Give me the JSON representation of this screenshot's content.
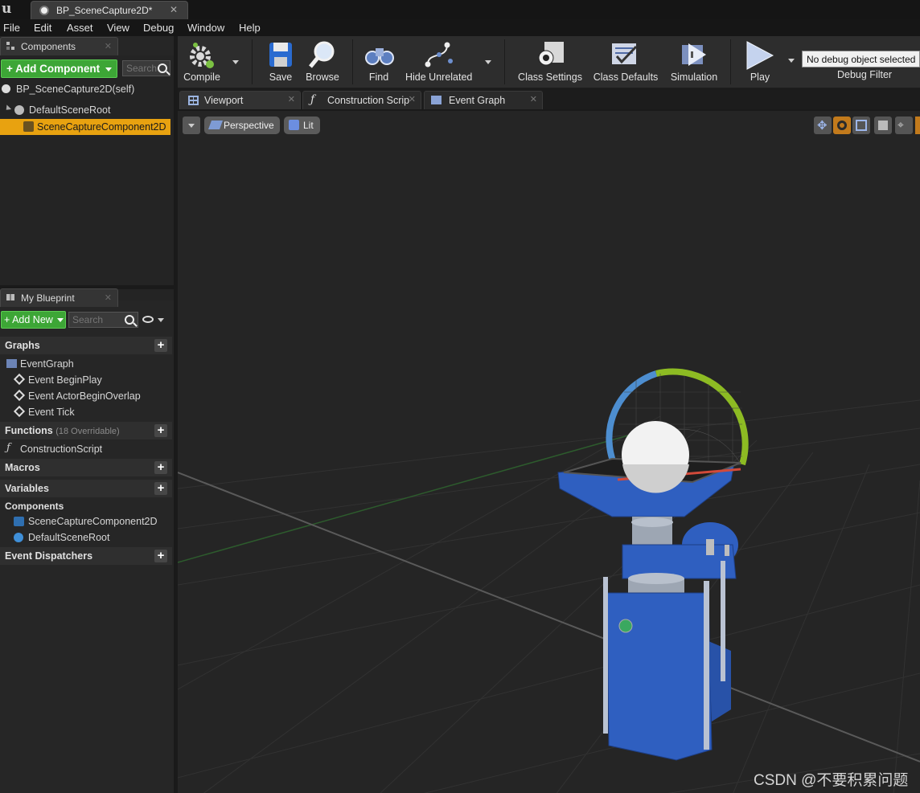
{
  "window": {
    "tab_title": "BP_SceneCapture2D*",
    "logo": "u"
  },
  "menu": [
    "File",
    "Edit",
    "Asset",
    "View",
    "Debug",
    "Window",
    "Help"
  ],
  "components_panel": {
    "tab_label": "Components",
    "add_component": "+ Add Component",
    "search_placeholder": "Search",
    "self_label": "BP_SceneCapture2D(self)",
    "tree": [
      "DefaultSceneRoot",
      "SceneCaptureComponent2D"
    ]
  },
  "my_blueprint": {
    "tab_label": "My Blueprint",
    "add_new": "+ Add New",
    "search_placeholder": "Search",
    "graphs_header": "Graphs",
    "event_graph": "EventGraph",
    "events": [
      "Event BeginPlay",
      "Event ActorBeginOverlap",
      "Event Tick"
    ],
    "functions_header": "Functions",
    "functions_overridable": "(18 Overridable)",
    "construction_script": "ConstructionScript",
    "macros_header": "Macros",
    "variables_header": "Variables",
    "components_header": "Components",
    "components": [
      "SceneCaptureComponent2D",
      "DefaultSceneRoot"
    ],
    "dispatchers_header": "Event Dispatchers"
  },
  "toolbar": {
    "compile": "Compile",
    "save": "Save",
    "browse": "Browse",
    "find": "Find",
    "hide_unrelated": "Hide Unrelated",
    "class_settings": "Class Settings",
    "class_defaults": "Class Defaults",
    "simulation": "Simulation",
    "play": "Play",
    "debug_object": "No debug object selected",
    "debug_filter": "Debug Filter"
  },
  "editor_tabs": [
    "Viewport",
    "Construction Scrip",
    "Event Graph"
  ],
  "viewport": {
    "perspective": "Perspective",
    "lit": "Lit"
  },
  "watermark": "CSDN @不要积累问题",
  "colors": {
    "accent_green": "#3da636",
    "selection": "#e8a210",
    "camera_blue": "#2f5fc0"
  }
}
